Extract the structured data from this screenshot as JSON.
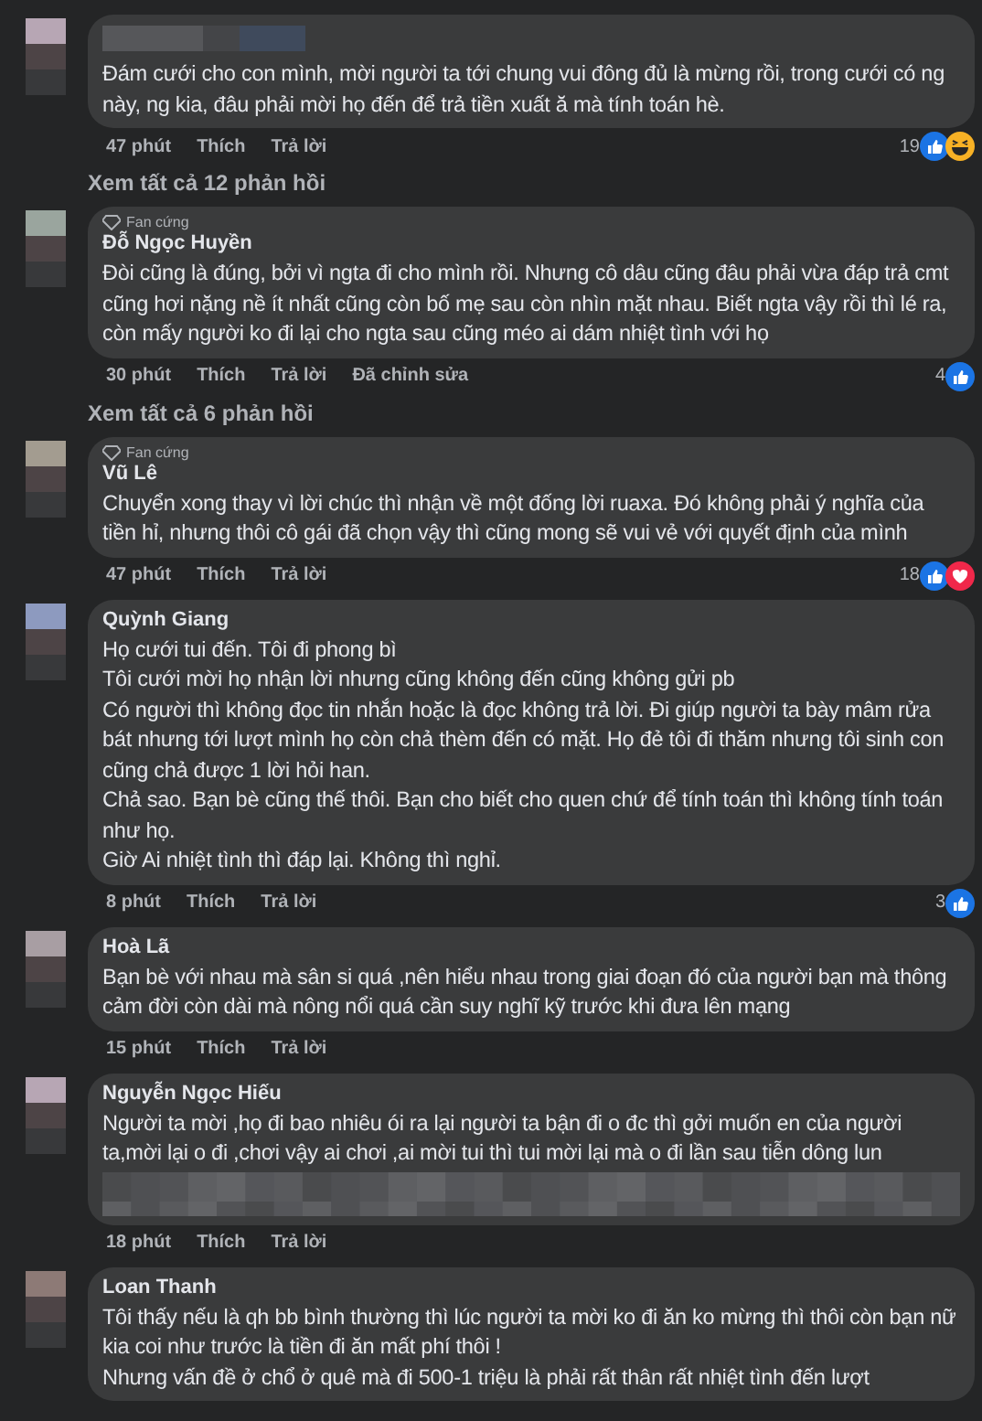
{
  "items": [
    {
      "kind": "comment",
      "paragraphs": [
        "Đám cưới cho con mình, mời người ta tới chung vui đông đủ là mừng rồi, trong cưới có ng này, ng kia, đâu phải mời họ đến để trả tiền xuất ă mà tính toán hè."
      ],
      "time": "47 phút",
      "like": "Thích",
      "reply": "Trả lời",
      "count": "19",
      "reactions": [
        {
          "kind": "like"
        },
        {
          "kind": "haha"
        }
      ]
    },
    {
      "kind": "replies_link",
      "text": "Xem tất cả 12 phản hồi"
    },
    {
      "kind": "comment",
      "badge": "Fan cứng",
      "name": "Đỗ Ngọc Huyền",
      "paragraphs": [
        "Đòi cũng là đúng, bởi vì ngta đi cho mình rồi. Nhưng cô dâu cũng đâu phải vừa đáp trả cmt cũng hơi nặng nề ít nhất cũng còn bố mẹ sau còn nhìn mặt nhau. Biết ngta vậy rồi thì lé ra, còn mấy người ko đi lại cho ngta sau cũng méo ai dám nhiệt tình với họ"
      ],
      "time": "30 phút",
      "like": "Thích",
      "reply": "Trả lời",
      "edited": "Đã chỉnh sửa",
      "count": "4",
      "reactions": [
        {
          "kind": "like"
        }
      ]
    },
    {
      "kind": "replies_link",
      "text": "Xem tất cả 6 phản hồi"
    },
    {
      "kind": "comment",
      "badge": "Fan cứng",
      "name": "Vũ Lê",
      "paragraphs": [
        "Chuyển xong thay vì lời chúc thì nhận về một đống lời ruaxa. Đó không phải ý nghĩa của tiền hỉ, nhưng thôi cô gái đã chọn vậy thì cũng mong sẽ vui vẻ với quyết định của mình"
      ],
      "time": "47 phút",
      "like": "Thích",
      "reply": "Trả lời",
      "count": "18",
      "reactions": [
        {
          "kind": "like"
        },
        {
          "kind": "love"
        }
      ]
    },
    {
      "kind": "comment",
      "name": "Quỳnh Giang",
      "paragraphs": [
        "Họ cưới tui đến. Tôi đi phong bì",
        "Tôi cưới mời họ nhận lời nhưng cũng không đến cũng không gửi pb",
        "Có người thì không đọc tin nhắn hoặc là đọc không trả lời. Đi giúp người ta bày mâm rửa bát nhưng tới lượt mình họ còn chả thèm đến có mặt. Họ đẻ tôi đi thăm nhưng tôi sinh con cũng chả được 1 lời hỏi han.",
        "Chả sao. Bạn bè cũng thế thôi. Bạn cho biết cho quen chứ để tính toán thì không tính toán như họ.",
        "Giờ Ai nhiệt tình thì đáp lại. Không thì nghỉ."
      ],
      "time": "8 phút",
      "like": "Thích",
      "reply": "Trả lời",
      "count": "3",
      "reactions": [
        {
          "kind": "like"
        }
      ]
    },
    {
      "kind": "comment",
      "name": "Hoà Lã",
      "paragraphs": [
        "Bạn bè với nhau mà sân si quá ,nên hiểu nhau trong giai đoạn đó của người bạn mà thông cảm đời còn dài mà nông nổi quá cần suy nghĩ kỹ trước khi đưa lên mạng"
      ],
      "time": "15 phút",
      "like": "Thích",
      "reply": "Trả lời"
    },
    {
      "kind": "comment",
      "name": "Nguyễn Ngọc Hiếu",
      "paragraphs": [
        "Người ta mời ,họ đi bao nhiêu ói ra lại người ta bận đi o đc thì gởi muốn en của người ta,mời lại o đi ,chơi vậy ai chơi ,ai mời tui thì tui mời lại mà o đi lần sau tiễn dông lun"
      ],
      "redacted": true,
      "time": "18 phút",
      "like": "Thích",
      "reply": "Trả lời"
    },
    {
      "kind": "comment",
      "name": "Loan Thanh",
      "paragraphs": [
        "Tôi thấy nếu là qh bb bình thường thì lúc người ta mời ko đi ăn ko mừng thì thôi còn bạn nữ kia coi như trước là tiền đi ăn mất phí thôi !",
        "Nhưng vấn đề ở chổ ở quê mà đi 500-1 triệu là phải rất thân rất nhiệt tình đến lượt"
      ]
    }
  ]
}
